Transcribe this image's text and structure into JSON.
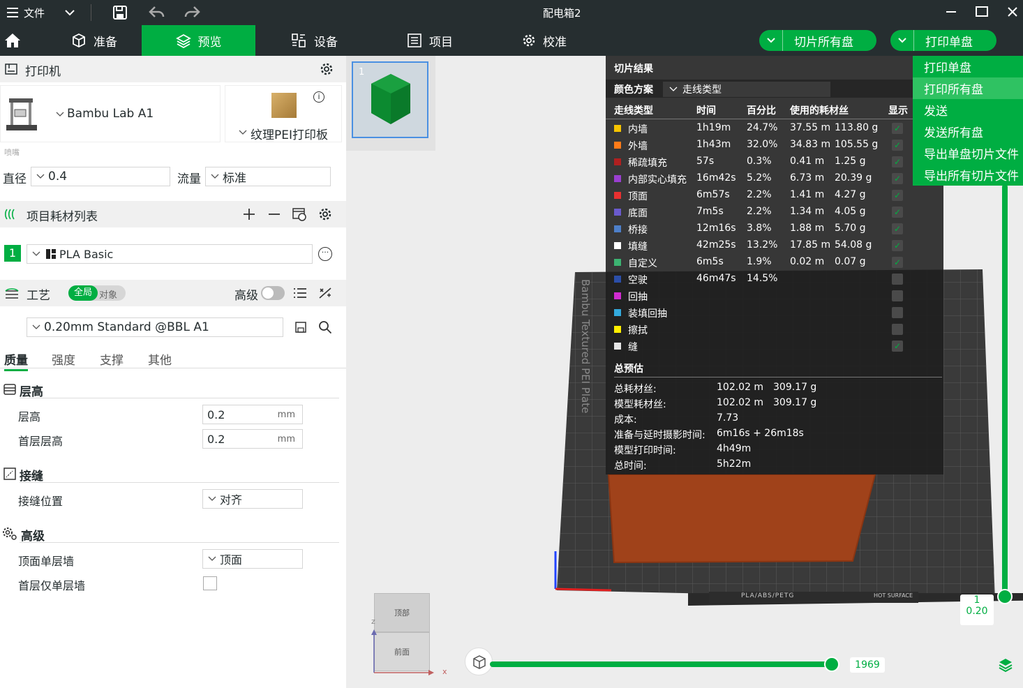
{
  "titlebar": {
    "menu_label": "文件",
    "title": "配电箱2"
  },
  "tabs": [
    {
      "label": "准备"
    },
    {
      "label": "预览"
    },
    {
      "label": "设备"
    },
    {
      "label": "项目"
    },
    {
      "label": "校准"
    }
  ],
  "actions": {
    "slice_all": "切片所有盘",
    "print_plate": "打印单盘"
  },
  "print_menu": [
    "打印单盘",
    "打印所有盘",
    "发送",
    "发送所有盘",
    "导出单盘切片文件",
    "导出所有切片文件"
  ],
  "printer": {
    "section": "打印机",
    "name": "Bambu Lab A1",
    "plate": "纹理PEI打印板",
    "nozzle_label": "喷嘴",
    "diameter_label": "直径",
    "diameter_value": "0.4",
    "flow_label": "流量",
    "flow_value": "标准"
  },
  "filament": {
    "section": "项目耗材列表",
    "index": "1",
    "name": "PLA Basic"
  },
  "process": {
    "section": "工艺",
    "toggle_global": "全局",
    "toggle_object": "对象",
    "advanced_label": "高级",
    "preset": "0.20mm Standard @BBL A1",
    "tabs": [
      "质量",
      "强度",
      "支撑",
      "其他"
    ],
    "groups": {
      "layer": {
        "title": "层高",
        "layer_height_label": "层高",
        "layer_height": "0.2",
        "first_layer_label": "首层层高",
        "first_layer": "0.2",
        "unit": "mm"
      },
      "seam": {
        "title": "接缝",
        "position_label": "接缝位置",
        "position": "对齐"
      },
      "advanced": {
        "title": "高级",
        "top_single_label": "顶面单层墙",
        "top_single": "顶面",
        "first_single_label": "首层仅单层墙"
      }
    }
  },
  "thumbnail": {
    "index": "1"
  },
  "slice_result": {
    "title": "切片结果",
    "scheme_label": "颜色方案",
    "scheme_value": "走线类型",
    "headers": [
      "走线类型",
      "时间",
      "百分比",
      "使用的耗材丝",
      "显示"
    ],
    "rows": [
      {
        "name": "内墙",
        "color": "#f5c400",
        "time": "1h19m",
        "pct": "24.7%",
        "len": "37.55 m",
        "weight": "113.80 g",
        "show": true
      },
      {
        "name": "外墙",
        "color": "#ff7b18",
        "time": "1h43m",
        "pct": "32.0%",
        "len": "34.83 m",
        "weight": "105.55 g",
        "show": true
      },
      {
        "name": "稀疏填充",
        "color": "#b02020",
        "time": "57s",
        "pct": "0.3%",
        "len": "0.41 m",
        "weight": "1.25 g",
        "show": true
      },
      {
        "name": "内部实心填充",
        "color": "#9a3fd0",
        "time": "16m42s",
        "pct": "5.2%",
        "len": "6.73 m",
        "weight": "20.39 g",
        "show": true
      },
      {
        "name": "顶面",
        "color": "#e83030",
        "time": "6m57s",
        "pct": "2.2%",
        "len": "1.41 m",
        "weight": "4.27 g",
        "show": true
      },
      {
        "name": "底面",
        "color": "#6a5acd",
        "time": "7m5s",
        "pct": "2.2%",
        "len": "1.34 m",
        "weight": "4.05 g",
        "show": true
      },
      {
        "name": "桥接",
        "color": "#4d7fc9",
        "time": "12m16s",
        "pct": "3.8%",
        "len": "1.88 m",
        "weight": "5.70 g",
        "show": true
      },
      {
        "name": "填缝",
        "color": "#ffffff",
        "time": "42m25s",
        "pct": "13.2%",
        "len": "17.85 m",
        "weight": "54.08 g",
        "show": true
      },
      {
        "name": "自定义",
        "color": "#3cb371",
        "time": "6m5s",
        "pct": "1.9%",
        "len": "0.02 m",
        "weight": "0.07 g",
        "show": true
      },
      {
        "name": "空驶",
        "color": "#2b4ea8",
        "time": "46m47s",
        "pct": "14.5%",
        "len": "",
        "weight": "",
        "show": false
      },
      {
        "name": "回抽",
        "color": "#d02bd0",
        "time": "",
        "pct": "",
        "len": "",
        "weight": "",
        "show": false
      },
      {
        "name": "装填回抽",
        "color": "#33aadd",
        "time": "",
        "pct": "",
        "len": "",
        "weight": "",
        "show": false
      },
      {
        "name": "擦拭",
        "color": "#ffee00",
        "time": "",
        "pct": "",
        "len": "",
        "weight": "",
        "show": false
      },
      {
        "name": "缝",
        "color": "#e6e6e6",
        "time": "",
        "pct": "",
        "len": "",
        "weight": "",
        "show": true
      }
    ],
    "summary_title": "总预估",
    "summary": [
      {
        "label": "总耗材丝:",
        "value": "102.02 m",
        "extra": "309.17 g"
      },
      {
        "label": "模型耗材丝:",
        "value": "102.02 m",
        "extra": "309.17 g"
      },
      {
        "label": "成本:",
        "value": "7.73",
        "extra": ""
      },
      {
        "label": "准备与延时摄影时间:",
        "value": "6m16s + 26m18s",
        "extra": ""
      },
      {
        "label": "模型打印时间:",
        "value": "4h49m",
        "extra": ""
      },
      {
        "label": "总时间:",
        "value": "5h22m",
        "extra": ""
      }
    ]
  },
  "bed": {
    "label": "Bambu Textured PEI Plate",
    "brand_strip": "PLA/ABS/PETG",
    "hot_label": "HOT SURFACE"
  },
  "view_cube": {
    "top": "顶部",
    "front": "前面",
    "axis_x": "x",
    "axis_z": "z"
  },
  "layer_slider": {
    "layer": "1",
    "height": "0.20"
  },
  "move_slider": {
    "value": "1969",
    "fraction": 0.98
  },
  "colors": {
    "accent": "#00ae42",
    "dark": "#262e30",
    "model": "#a0421a"
  }
}
